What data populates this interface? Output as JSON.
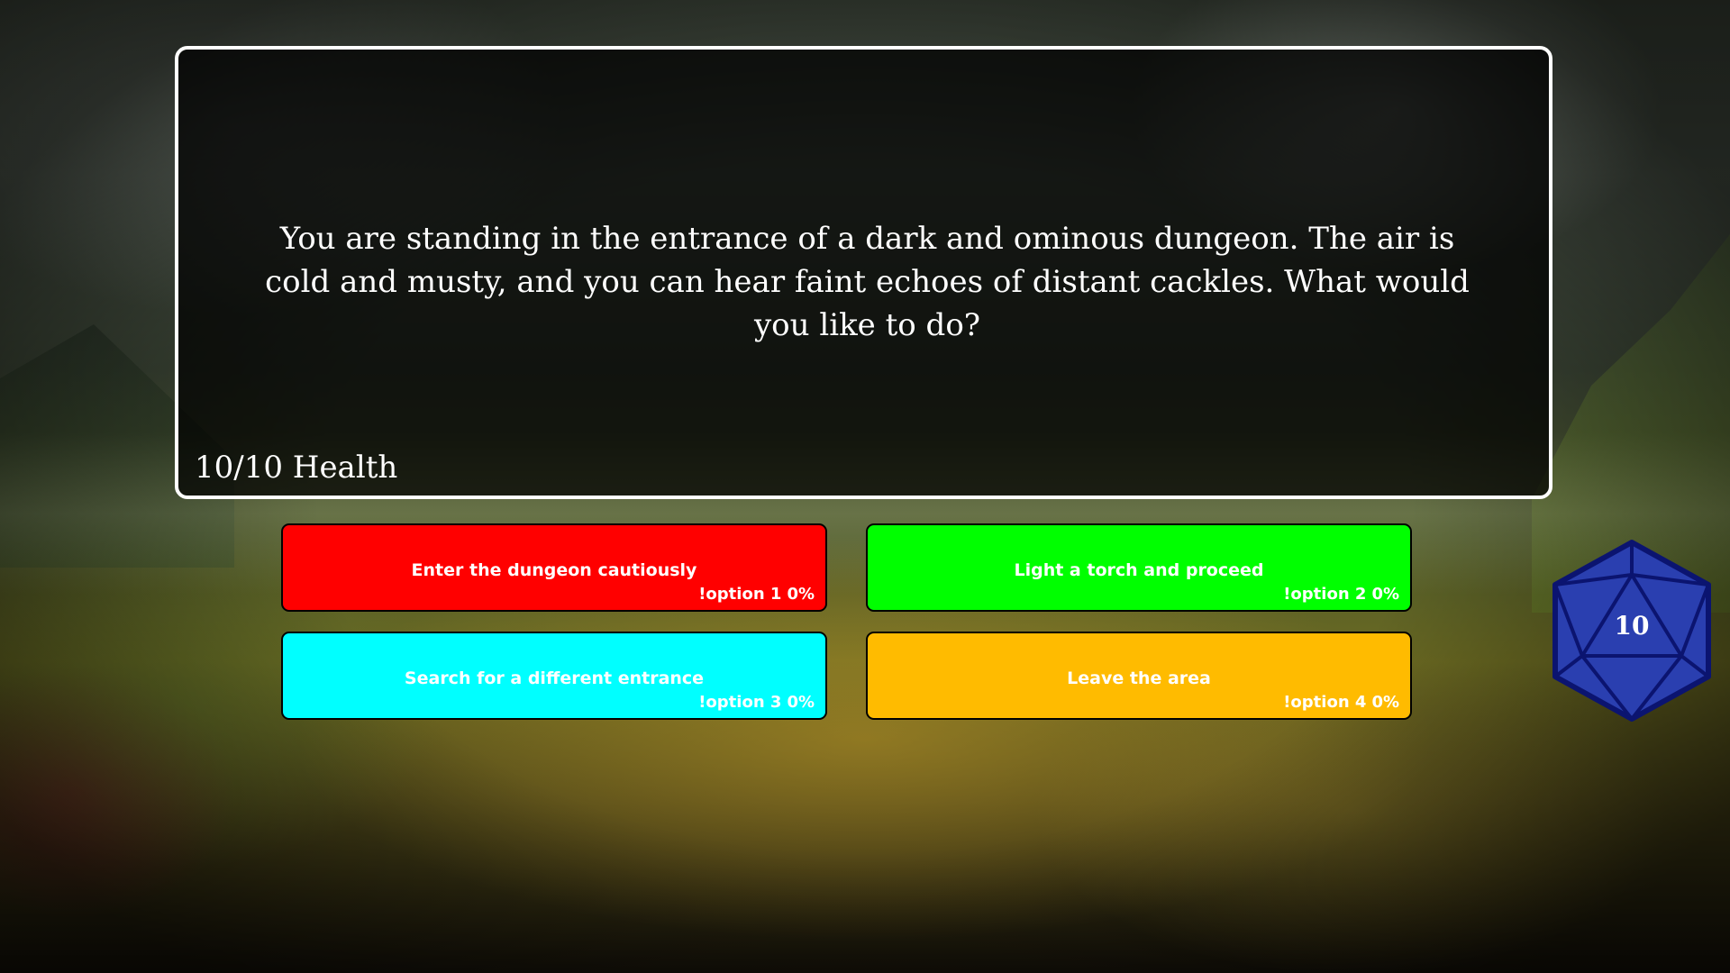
{
  "scene": {
    "story_text": "You are standing in the entrance of a dark and ominous dungeon. The air is cold and musty, and you can hear faint echoes of distant cackles. What would you like to do?",
    "health": "10/10 Health"
  },
  "options": [
    {
      "label": "Enter the dungeon cautiously",
      "command": "!option 1",
      "percent": "0%",
      "color": "#ff0000"
    },
    {
      "label": "Light a torch and proceed",
      "command": "!option 2",
      "percent": "0%",
      "color": "#00ff00"
    },
    {
      "label": "Search for a different entrance",
      "command": "!option 3",
      "percent": "0%",
      "color": "#00ffff"
    },
    {
      "label": "Leave the area",
      "command": "!option 4",
      "percent": "0%",
      "color": "#ffbb00"
    }
  ],
  "die": {
    "icon": "d20-icon",
    "value": "10",
    "fill_color": "#2a3fb0",
    "edge_color": "#0b1470"
  }
}
